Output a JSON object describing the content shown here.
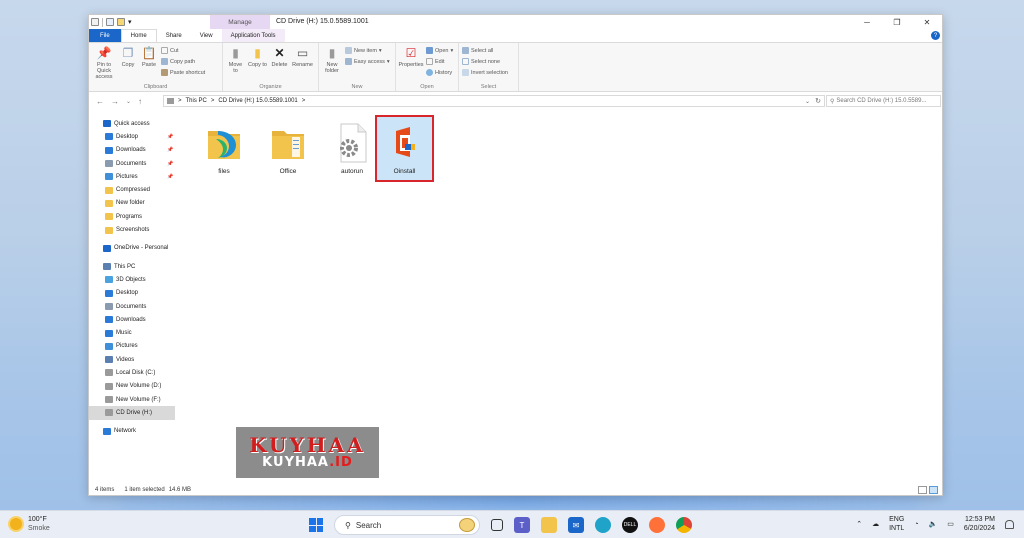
{
  "window": {
    "title": "CD Drive (H:) 15.0.5589.1001",
    "contextual_tab": "Manage",
    "controls": {
      "minimize": "─",
      "maximize": "❐",
      "close": "✕"
    }
  },
  "tabs": [
    {
      "label": "File"
    },
    {
      "label": "Home"
    },
    {
      "label": "Share"
    },
    {
      "label": "View"
    },
    {
      "label": "Application Tools"
    }
  ],
  "help_label": "?",
  "ribbon": {
    "clipboard": {
      "label": "Clipboard",
      "pin": "Pin to Quick access",
      "copy": "Copy",
      "paste": "Paste",
      "cut": "Cut",
      "copy_path": "Copy path",
      "paste_shortcut": "Paste shortcut"
    },
    "organize": {
      "label": "Organize",
      "move_to": "Move to",
      "copy_to": "Copy to",
      "delete": "Delete",
      "rename": "Rename"
    },
    "new": {
      "label": "New",
      "new_folder": "New folder",
      "new_item": "New item",
      "easy_access": "Easy access"
    },
    "open": {
      "label": "Open",
      "properties": "Properties",
      "open": "Open",
      "edit": "Edit",
      "history": "History"
    },
    "select": {
      "label": "Select",
      "select_all": "Select all",
      "select_none": "Select none",
      "invert": "Invert selection"
    }
  },
  "address": {
    "segments": [
      "This PC",
      "CD Drive (H:) 15.0.5589.1001"
    ],
    "separator": ">",
    "search_placeholder": "Search CD Drive (H:) 15.0.5589..."
  },
  "nav": {
    "items": [
      {
        "label": "Quick access",
        "icon": "star-icon",
        "pinned": false
      },
      {
        "label": "Desktop",
        "icon": "desktop-icon",
        "pinned": true
      },
      {
        "label": "Downloads",
        "icon": "download-icon",
        "pinned": true
      },
      {
        "label": "Documents",
        "icon": "documents-icon",
        "pinned": true
      },
      {
        "label": "Pictures",
        "icon": "pictures-icon",
        "pinned": true
      },
      {
        "label": "Compressed",
        "icon": "folder-icon",
        "pinned": false
      },
      {
        "label": "New folder",
        "icon": "folder-icon",
        "pinned": false
      },
      {
        "label": "Programs",
        "icon": "folder-icon",
        "pinned": false
      },
      {
        "label": "Screenshots",
        "icon": "folder-icon",
        "pinned": false
      },
      {
        "label": "OneDrive - Personal",
        "icon": "cloud-icon",
        "pinned": false
      },
      {
        "label": "This PC",
        "icon": "pc-icon",
        "pinned": false
      },
      {
        "label": "3D Objects",
        "icon": "cube-icon",
        "pinned": false
      },
      {
        "label": "Desktop",
        "icon": "desktop-icon",
        "pinned": false
      },
      {
        "label": "Documents",
        "icon": "documents-icon",
        "pinned": false
      },
      {
        "label": "Downloads",
        "icon": "download-icon",
        "pinned": false
      },
      {
        "label": "Music",
        "icon": "music-icon",
        "pinned": false
      },
      {
        "label": "Pictures",
        "icon": "pictures-icon",
        "pinned": false
      },
      {
        "label": "Videos",
        "icon": "videos-icon",
        "pinned": false
      },
      {
        "label": "Local Disk (C:)",
        "icon": "drive-icon",
        "pinned": false
      },
      {
        "label": "New Volume (D:)",
        "icon": "drive-icon",
        "pinned": false
      },
      {
        "label": "New Volume (F:)",
        "icon": "drive-icon",
        "pinned": false
      },
      {
        "label": "CD Drive (H:)",
        "icon": "cd-drive-icon",
        "pinned": false
      },
      {
        "label": "Network",
        "icon": "network-icon",
        "pinned": false
      }
    ]
  },
  "files": [
    {
      "name": "files",
      "type": "folder"
    },
    {
      "name": "Office",
      "type": "folder"
    },
    {
      "name": "autorun",
      "type": "settings-file"
    },
    {
      "name": "Oinstall",
      "type": "office-app"
    }
  ],
  "status": {
    "count": "4 items",
    "selection": "1 item selected",
    "size": "14.6 MB"
  },
  "watermark": {
    "line1": "KUYHAA",
    "line2_a": "KUYHAA",
    "line2_b": ".ID"
  },
  "taskbar": {
    "weather_temp": "100°F",
    "weather_desc": "Smoke",
    "search_label": "Search",
    "lang": "ENG",
    "layout": "INTL",
    "time": "12:53 PM",
    "date": "6/20/2024"
  },
  "colors": {
    "accent": "#1b66c9",
    "selection_bg": "#cce4f7",
    "selection_border": "#d9262c",
    "folder": "#f3c44b"
  }
}
